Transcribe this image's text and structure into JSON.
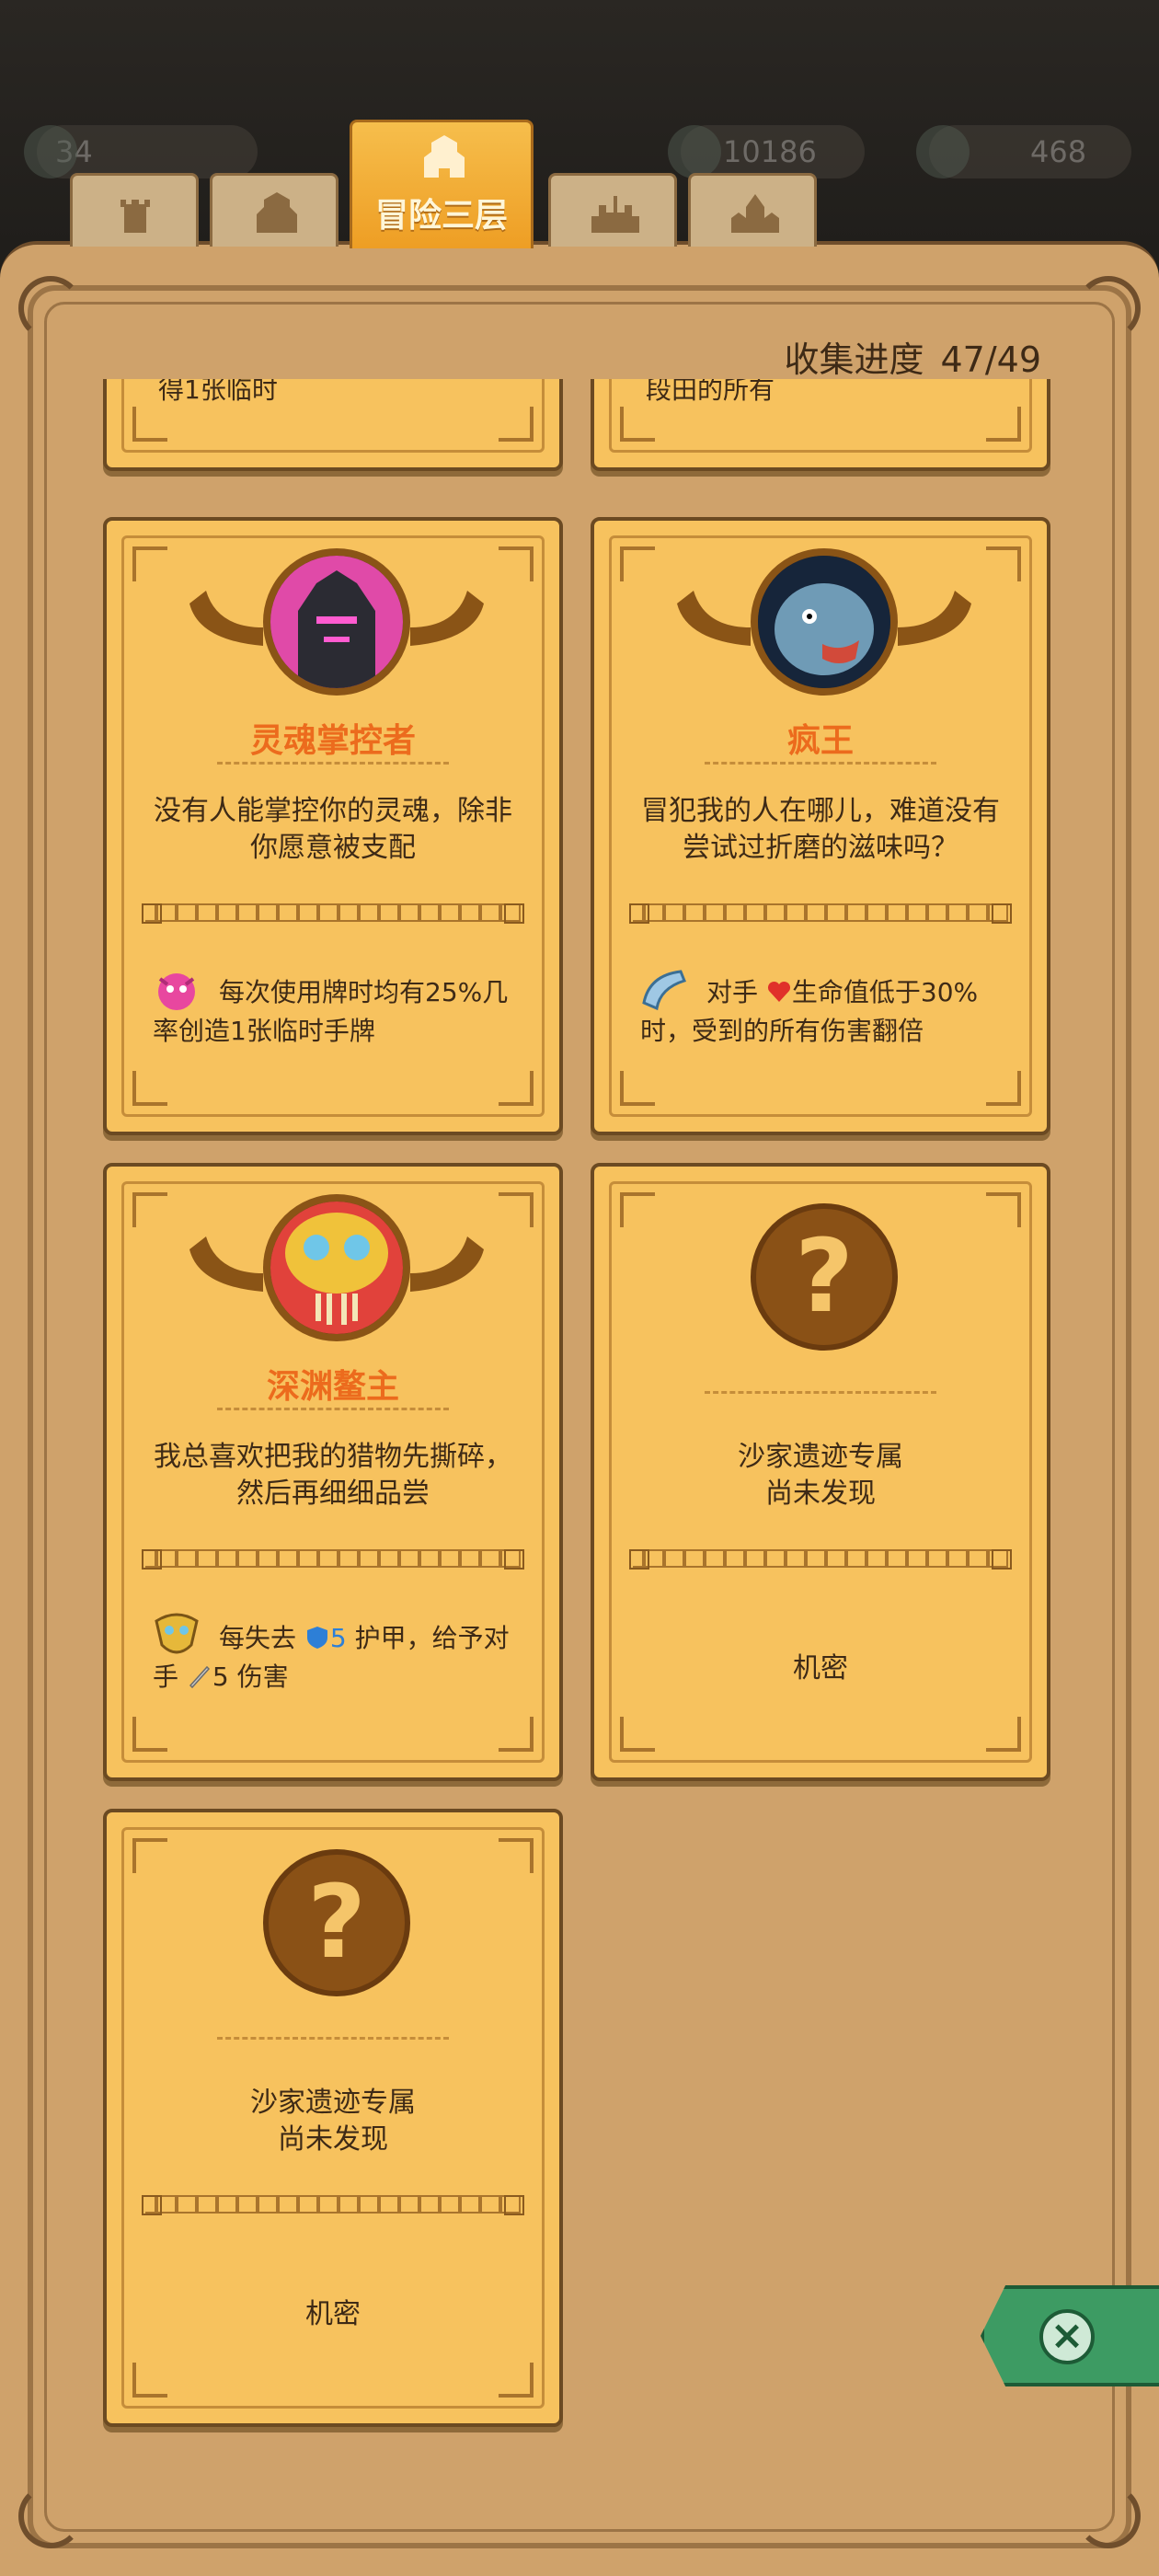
{
  "topbar": {
    "stats": [
      {
        "value": "34",
        "icon": "gem-icon"
      },
      {
        "value": "10186",
        "icon": "pyramid-icon"
      },
      {
        "value": "468",
        "icon": "leaf-icon"
      }
    ]
  },
  "tabs": [
    {
      "name": "floor-1",
      "icon": "tower-icon",
      "label": ""
    },
    {
      "name": "floor-2",
      "icon": "castle-icon",
      "label": ""
    },
    {
      "name": "floor-3",
      "icon": "castle-icon",
      "label": "冒险三层",
      "active": true
    },
    {
      "name": "floor-4",
      "icon": "fortress-icon",
      "label": ""
    },
    {
      "name": "floor-5",
      "icon": "palace-icon",
      "label": ""
    }
  ],
  "progress": {
    "label": "收集进度",
    "value": "47/49"
  },
  "cards": [
    {
      "name": "灵魂掌控者",
      "lore": "没有人能掌控你的灵魂，除非你愿意被支配",
      "ability": "每次使用牌时均有25%几率创造1张临时手牌",
      "ability_icon": "pink-spirit-icon"
    },
    {
      "name": "疯王",
      "lore": "冒犯我的人在哪儿，难道没有尝试过折磨的滋味吗？",
      "ability_pre": "对手",
      "ability_post": "生命值低于30%时，受到的所有伤害翻倍",
      "ability_icon": "horn-icon"
    },
    {
      "name": "深渊鳌主",
      "lore": "我总喜欢把我的猎物先撕碎，然后再细细品尝",
      "ability_a": "每失去",
      "ability_armor": "5",
      "ability_b": "护甲，给予对手",
      "ability_dmg": "5 伤害",
      "ability_icon": "gold-mask-icon"
    },
    {
      "locked_line1": "沙家遗迹专属",
      "locked_line2": "尚未发现",
      "secret": "机密"
    },
    {
      "locked_line1": "沙家遗迹专属",
      "locked_line2": "尚未发现",
      "secret": "机密"
    }
  ],
  "partial_cards": [
    {
      "text": "得1张临时"
    },
    {
      "text": "段田的所有"
    }
  ],
  "colors": {
    "card": "#f7c25e",
    "board": "#cfa26b",
    "name": "#ec6b1d",
    "close": "#3d9b63"
  }
}
